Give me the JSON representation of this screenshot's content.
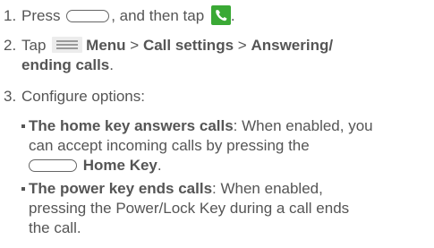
{
  "steps": [
    {
      "num": "1.",
      "before": "Press",
      "middle": ", and then tap",
      "after": "."
    },
    {
      "num": "2.",
      "tap": "Tap",
      "menu": "Menu",
      "sep1": ">",
      "call_settings": "Call settings",
      "sep2": ">",
      "answering_line1": "Answering/",
      "answering_line2": "ending calls",
      "period": "."
    },
    {
      "num": "3.",
      "text": "Configure options:"
    }
  ],
  "options": [
    {
      "title": "The home key answers calls",
      "line1_rest": ": When enabled, you",
      "line2": "can accept incoming calls by pressing the",
      "key_label": "Home Key",
      "period": "."
    },
    {
      "title": "The power key ends calls",
      "line1_rest": ": When enabled,",
      "line2": "pressing the Power/Lock Key during a call ends",
      "line3": "the call."
    }
  ],
  "icons": {
    "home_key": "home-key-icon",
    "phone_app": "phone-app-icon",
    "menu": "menu-icon"
  },
  "colors": {
    "text": "#555555",
    "phone_green": "#3aa935"
  }
}
